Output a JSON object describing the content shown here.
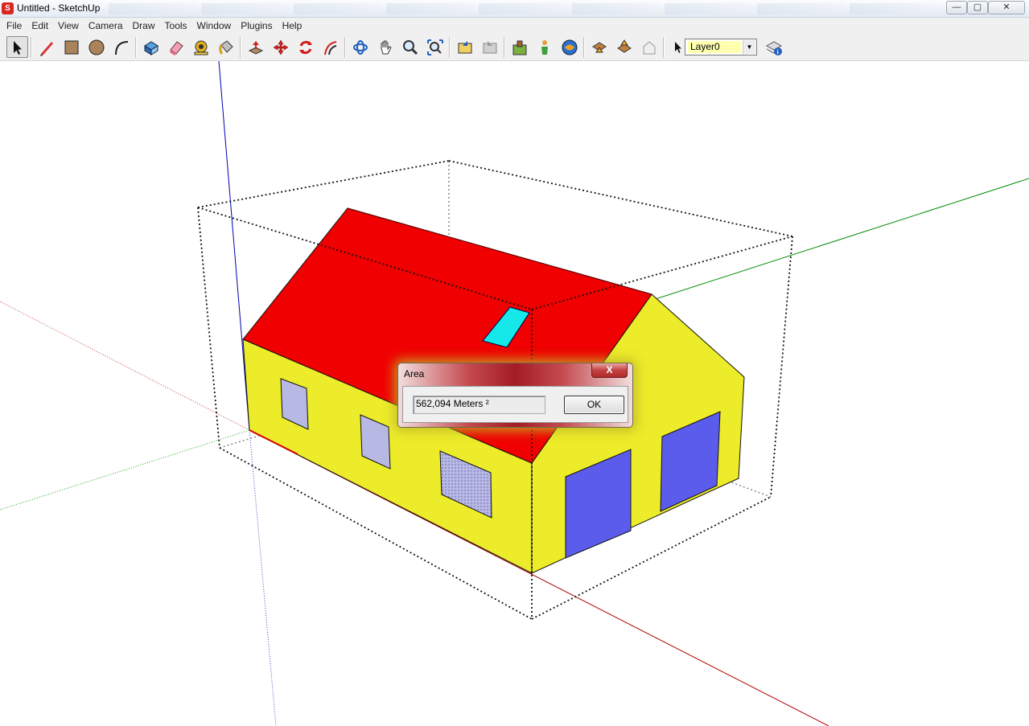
{
  "window": {
    "title": "Untitled - SketchUp",
    "app_icon": "S",
    "minimize_glyph": "—",
    "maximize_glyph": "▢",
    "close_glyph": "✕"
  },
  "menu": [
    "File",
    "Edit",
    "View",
    "Camera",
    "Draw",
    "Tools",
    "Window",
    "Plugins",
    "Help"
  ],
  "toolbar": {
    "tools": [
      "select-tool",
      "pencil-line-tool",
      "rectangle-tool",
      "circle-tool",
      "arc-tool",
      "make-component-tool",
      "eraser-tool",
      "tape-measure-tool",
      "paint-bucket-tool",
      "push-pull-tool",
      "move-tool",
      "rotate-tool",
      "offset-tool",
      "orbit-tool",
      "pan-tool",
      "zoom-tool",
      "zoom-extents-tool",
      "previous-view-tool",
      "next-view-tool",
      "add-location-tool",
      "position-camera-tool",
      "google-earth-tool",
      "get-models-tool",
      "share-model-tool",
      "share-component-tool"
    ],
    "active_tool": "select-tool",
    "layer": {
      "value": "Layer0",
      "arrow": "▼"
    }
  },
  "viewport": {
    "colors": {
      "roof": "#f00000",
      "wall": "#ecec2a",
      "door": "#5c5cec",
      "window": "#b8b8e4",
      "skylight": "#16e8ea",
      "axis_red": "#b00000",
      "axis_green": "#008a00",
      "axis_blue": "#0000b0"
    }
  },
  "dialog": {
    "title": "Area",
    "close_glyph": "X",
    "value": "562,094 Meters ²",
    "ok_label": "OK"
  }
}
